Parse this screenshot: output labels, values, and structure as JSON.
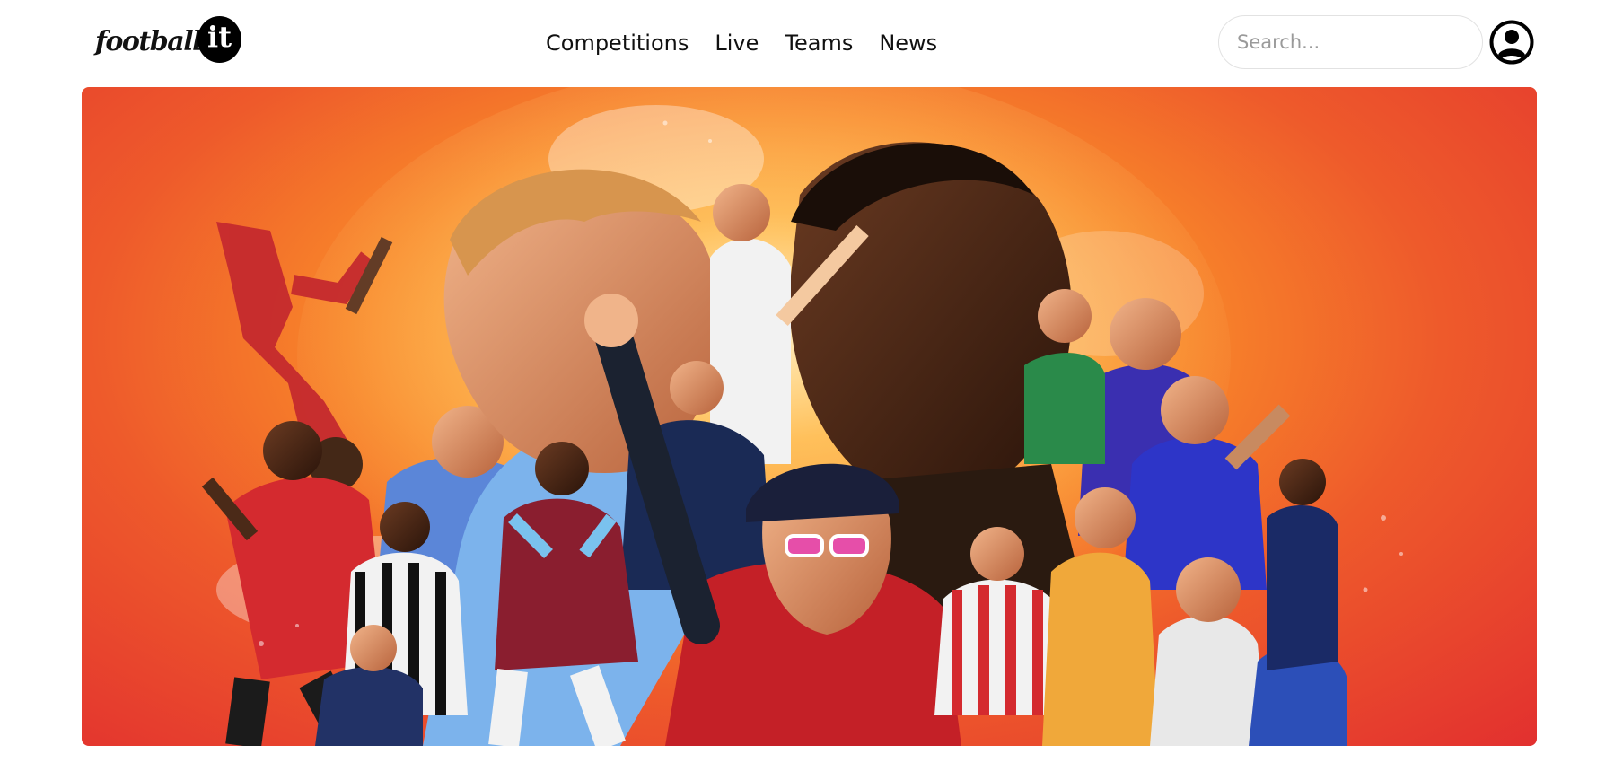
{
  "brand": {
    "logo_text": "football",
    "logo_badge": "it"
  },
  "nav": {
    "items": [
      {
        "label": "Competitions"
      },
      {
        "label": "Live"
      },
      {
        "label": "Teams"
      },
      {
        "label": "News"
      }
    ]
  },
  "search": {
    "placeholder": "Search...",
    "value": ""
  },
  "user": {
    "icon": "user-circle-icon"
  },
  "hero": {
    "description_icon": "football-players-collage",
    "colors": {
      "outer": "#e2302f",
      "mid": "#f8862a",
      "glow": "#ffd27a"
    }
  }
}
